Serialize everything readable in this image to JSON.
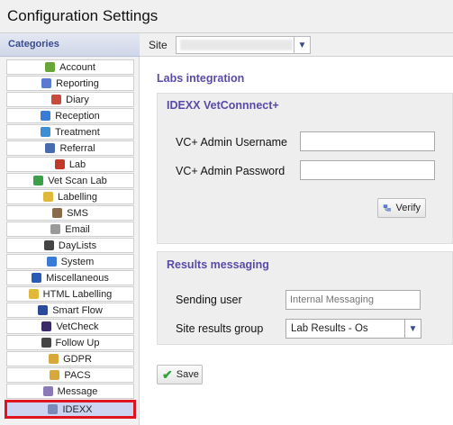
{
  "window": {
    "title": "Configuration Settings"
  },
  "sidebar": {
    "header": "Categories",
    "items": [
      {
        "label": "Account",
        "icon": "account-icon",
        "color": "#6aa53a"
      },
      {
        "label": "Reporting",
        "icon": "reporting-icon",
        "color": "#5a7bd0"
      },
      {
        "label": "Diary",
        "icon": "diary-icon",
        "color": "#c94a3a"
      },
      {
        "label": "Reception",
        "icon": "reception-icon",
        "color": "#3a7bd5"
      },
      {
        "label": "Treatment",
        "icon": "treatment-icon",
        "color": "#3a8fd5"
      },
      {
        "label": "Referral",
        "icon": "referral-icon",
        "color": "#4a6ab0"
      },
      {
        "label": "Lab",
        "icon": "lab-icon",
        "color": "#c0392b"
      },
      {
        "label": "Vet Scan Lab",
        "icon": "vet-scan-lab-icon",
        "color": "#3aa04a"
      },
      {
        "label": "Labelling",
        "icon": "labelling-icon",
        "color": "#e0b93a"
      },
      {
        "label": "SMS",
        "icon": "sms-icon",
        "color": "#8a6a4a"
      },
      {
        "label": "Email",
        "icon": "email-icon",
        "color": "#9a9a9a"
      },
      {
        "label": "DayLists",
        "icon": "daylists-icon",
        "color": "#444444"
      },
      {
        "label": "System",
        "icon": "system-icon",
        "color": "#3a7bd5"
      },
      {
        "label": "Miscellaneous",
        "icon": "miscellaneous-icon",
        "color": "#2a5ab8"
      },
      {
        "label": "HTML Labelling",
        "icon": "html-labelling-icon",
        "color": "#e0b93a"
      },
      {
        "label": "Smart Flow",
        "icon": "smart-flow-icon",
        "color": "#2a4a9a"
      },
      {
        "label": "VetCheck",
        "icon": "vetcheck-icon",
        "color": "#3a2a6a"
      },
      {
        "label": "Follow Up",
        "icon": "follow-up-icon",
        "color": "#444444"
      },
      {
        "label": "GDPR",
        "icon": "gdpr-icon",
        "color": "#d8a83a"
      },
      {
        "label": "PACS",
        "icon": "pacs-icon",
        "color": "#d8a83a"
      },
      {
        "label": "Message",
        "icon": "message-icon",
        "color": "#8a7ab8"
      },
      {
        "label": "IDEXX",
        "icon": "idexx-icon",
        "color": "#7a8ab8",
        "selected": true
      }
    ]
  },
  "site": {
    "label": "Site",
    "value": ""
  },
  "labs": {
    "heading": "Labs integration",
    "vetconnect_heading": "IDEXX VetConnnect+",
    "username_label": "VC+ Admin Username",
    "username_value": "",
    "password_label": "VC+ Admin Password",
    "password_value": "",
    "verify_label": "Verify"
  },
  "results": {
    "heading": "Results messaging",
    "sending_user_label": "Sending user",
    "sending_user_placeholder": "Internal Messaging",
    "site_results_group_label": "Site results group",
    "site_results_group_value": "Lab Results - Os"
  },
  "save_label": "Save",
  "accent_color": "#5a4aa8",
  "selection_border_color": "#e0141e"
}
